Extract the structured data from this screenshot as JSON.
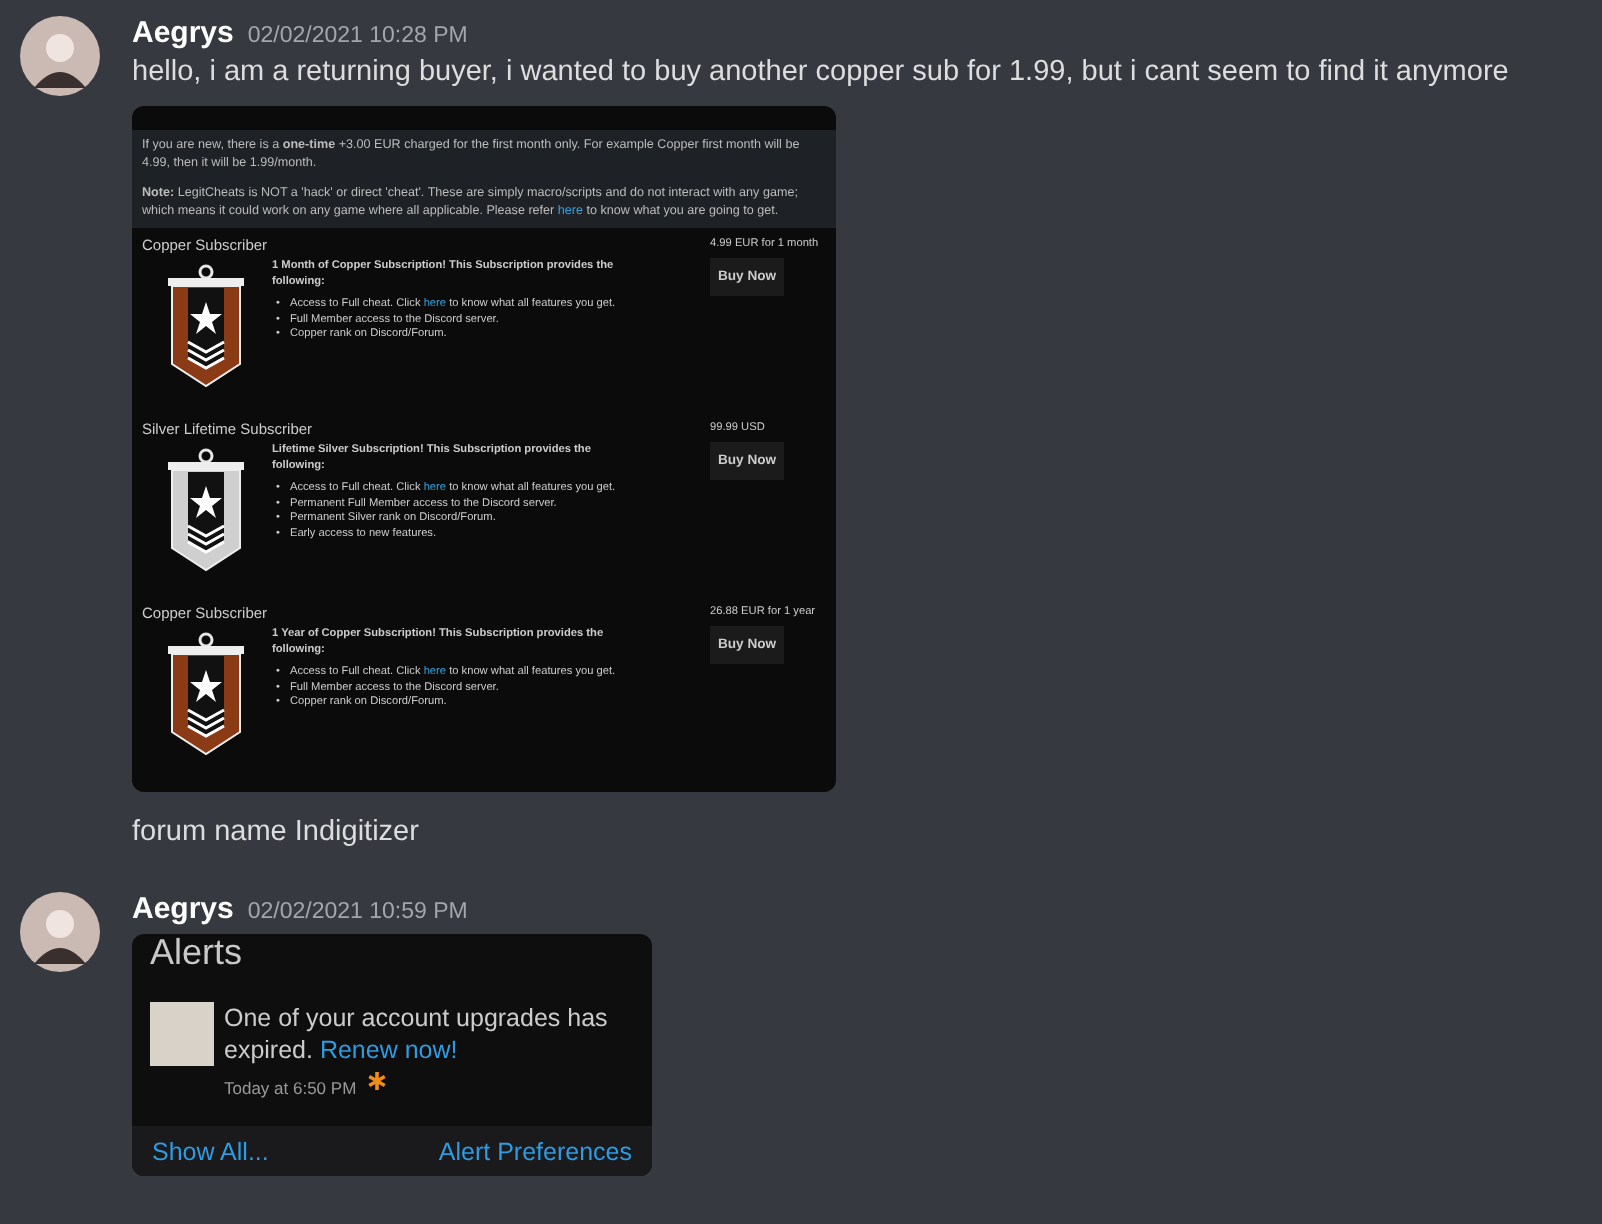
{
  "messages": [
    {
      "author": "Aegrys",
      "timestamp": "02/02/2021 10:28 PM",
      "blocks": [
        {
          "kind": "text",
          "text": "hello, i am a returning buyer, i wanted to buy another copper sub for 1.99, but i cant seem to find it anymore"
        },
        {
          "kind": "store",
          "intro": "If you are new, there is a **one-time** +3.00 EUR charged for the first month only. For example Copper first month will be 4.99, then it will be 1.99/month.",
          "note_label": "Note:",
          "note_before": "LegitCheats is NOT a 'hack' or direct 'cheat'. These are simply macro/scripts and do not interact with any game; which means it could work on any game where all applicable. Please refer",
          "note_link": "here",
          "note_after": "to know what you are going to get.",
          "plans": [
            {
              "title": "Copper Subscriber",
              "color": "#8a3a14",
              "heading": "1 Month of Copper Subscription! This Subscription provides the following:",
              "price": "4.99 EUR for 1 month",
              "button": "Buy Now",
              "bullets": [
                {
                  "marker": "•",
                  "before": "Access to Full cheat. Click",
                  "link": "here",
                  "after": "to know what all features you get."
                },
                {
                  "marker": "•",
                  "before": "Full Member access to the Discord server."
                },
                {
                  "marker": "•",
                  "before": "Copper rank on Discord/Forum."
                }
              ]
            },
            {
              "title": "Silver Lifetime Subscriber",
              "color": "#cfcfcf",
              "heading": "Lifetime Silver Subscription! This Subscription provides the following:",
              "price": "99.99 USD",
              "button": "Buy Now",
              "bullets": [
                {
                  "marker": "•",
                  "before": "Access to Full cheat. Click",
                  "link": "here",
                  "after": "to know what all features you get."
                },
                {
                  "marker": "•",
                  "before": "Permanent Full Member access to the Discord server."
                },
                {
                  "marker": "•",
                  "before": "Permanent Silver rank on Discord/Forum."
                },
                {
                  "marker": "•",
                  "before": "Early access to new features."
                }
              ]
            },
            {
              "title": "Copper Subscriber",
              "color": "#8a3a14",
              "heading": "1 Year of Copper Subscription! This Subscription provides the following:",
              "price": "26.88 EUR for 1 year",
              "button": "Buy Now",
              "bullets": [
                {
                  "marker": "•",
                  "before": "Access to Full cheat. Click",
                  "link": "here",
                  "after": "to know what all features you get."
                },
                {
                  "marker": "•",
                  "before": "Full Member access to the Discord server."
                },
                {
                  "marker": "•",
                  "before": "Copper rank on Discord/Forum."
                }
              ]
            }
          ]
        },
        {
          "kind": "text",
          "text": "forum name Indigitizer"
        }
      ]
    },
    {
      "author": "Aegrys",
      "timestamp": "02/02/2021 10:59 PM",
      "blocks": [
        {
          "kind": "alerts",
          "title": "Alerts",
          "message": "One of your account upgrades has expired.",
          "link": "Renew now!",
          "time": "Today at 6:50 PM",
          "unread": true,
          "footer_left": "Show All...",
          "footer_right": "Alert Preferences"
        }
      ]
    }
  ]
}
